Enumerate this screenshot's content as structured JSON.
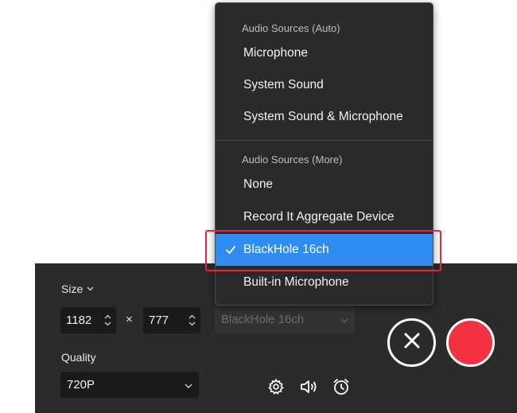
{
  "panel": {
    "size_label": "Size",
    "width_value": "1182",
    "times_symbol": "×",
    "height_value": "777",
    "audio_source_value": "BlackHole 16ch",
    "quality_label": "Quality",
    "quality_value": "720P"
  },
  "icons": {
    "size_chevron": "chevron-down-icon",
    "steppers": "stepper-arrows-icon",
    "settings": "gear-icon",
    "audio": "speaker-icon",
    "schedule": "alarm-clock-icon",
    "close": "close-icon",
    "record": "record-icon",
    "check": "checkmark-icon"
  },
  "menu": {
    "header_auto": "Audio Sources (Auto)",
    "auto_items": [
      {
        "label": "Microphone"
      },
      {
        "label": "System Sound"
      },
      {
        "label": "System Sound & Microphone"
      }
    ],
    "header_more": "Audio Sources (More)",
    "more_items": [
      {
        "label": "None"
      },
      {
        "label": "Record It Aggregate Device"
      },
      {
        "label": "BlackHole 16ch",
        "selected": true
      },
      {
        "label": "Built-in Microphone"
      }
    ]
  },
  "colors": {
    "panel_bg": "#2b2b2b",
    "menu_bg": "#2a2a2a",
    "selection_blue": "#2f8cf1",
    "record_red": "#f23240",
    "highlight_red": "#e8253a"
  }
}
